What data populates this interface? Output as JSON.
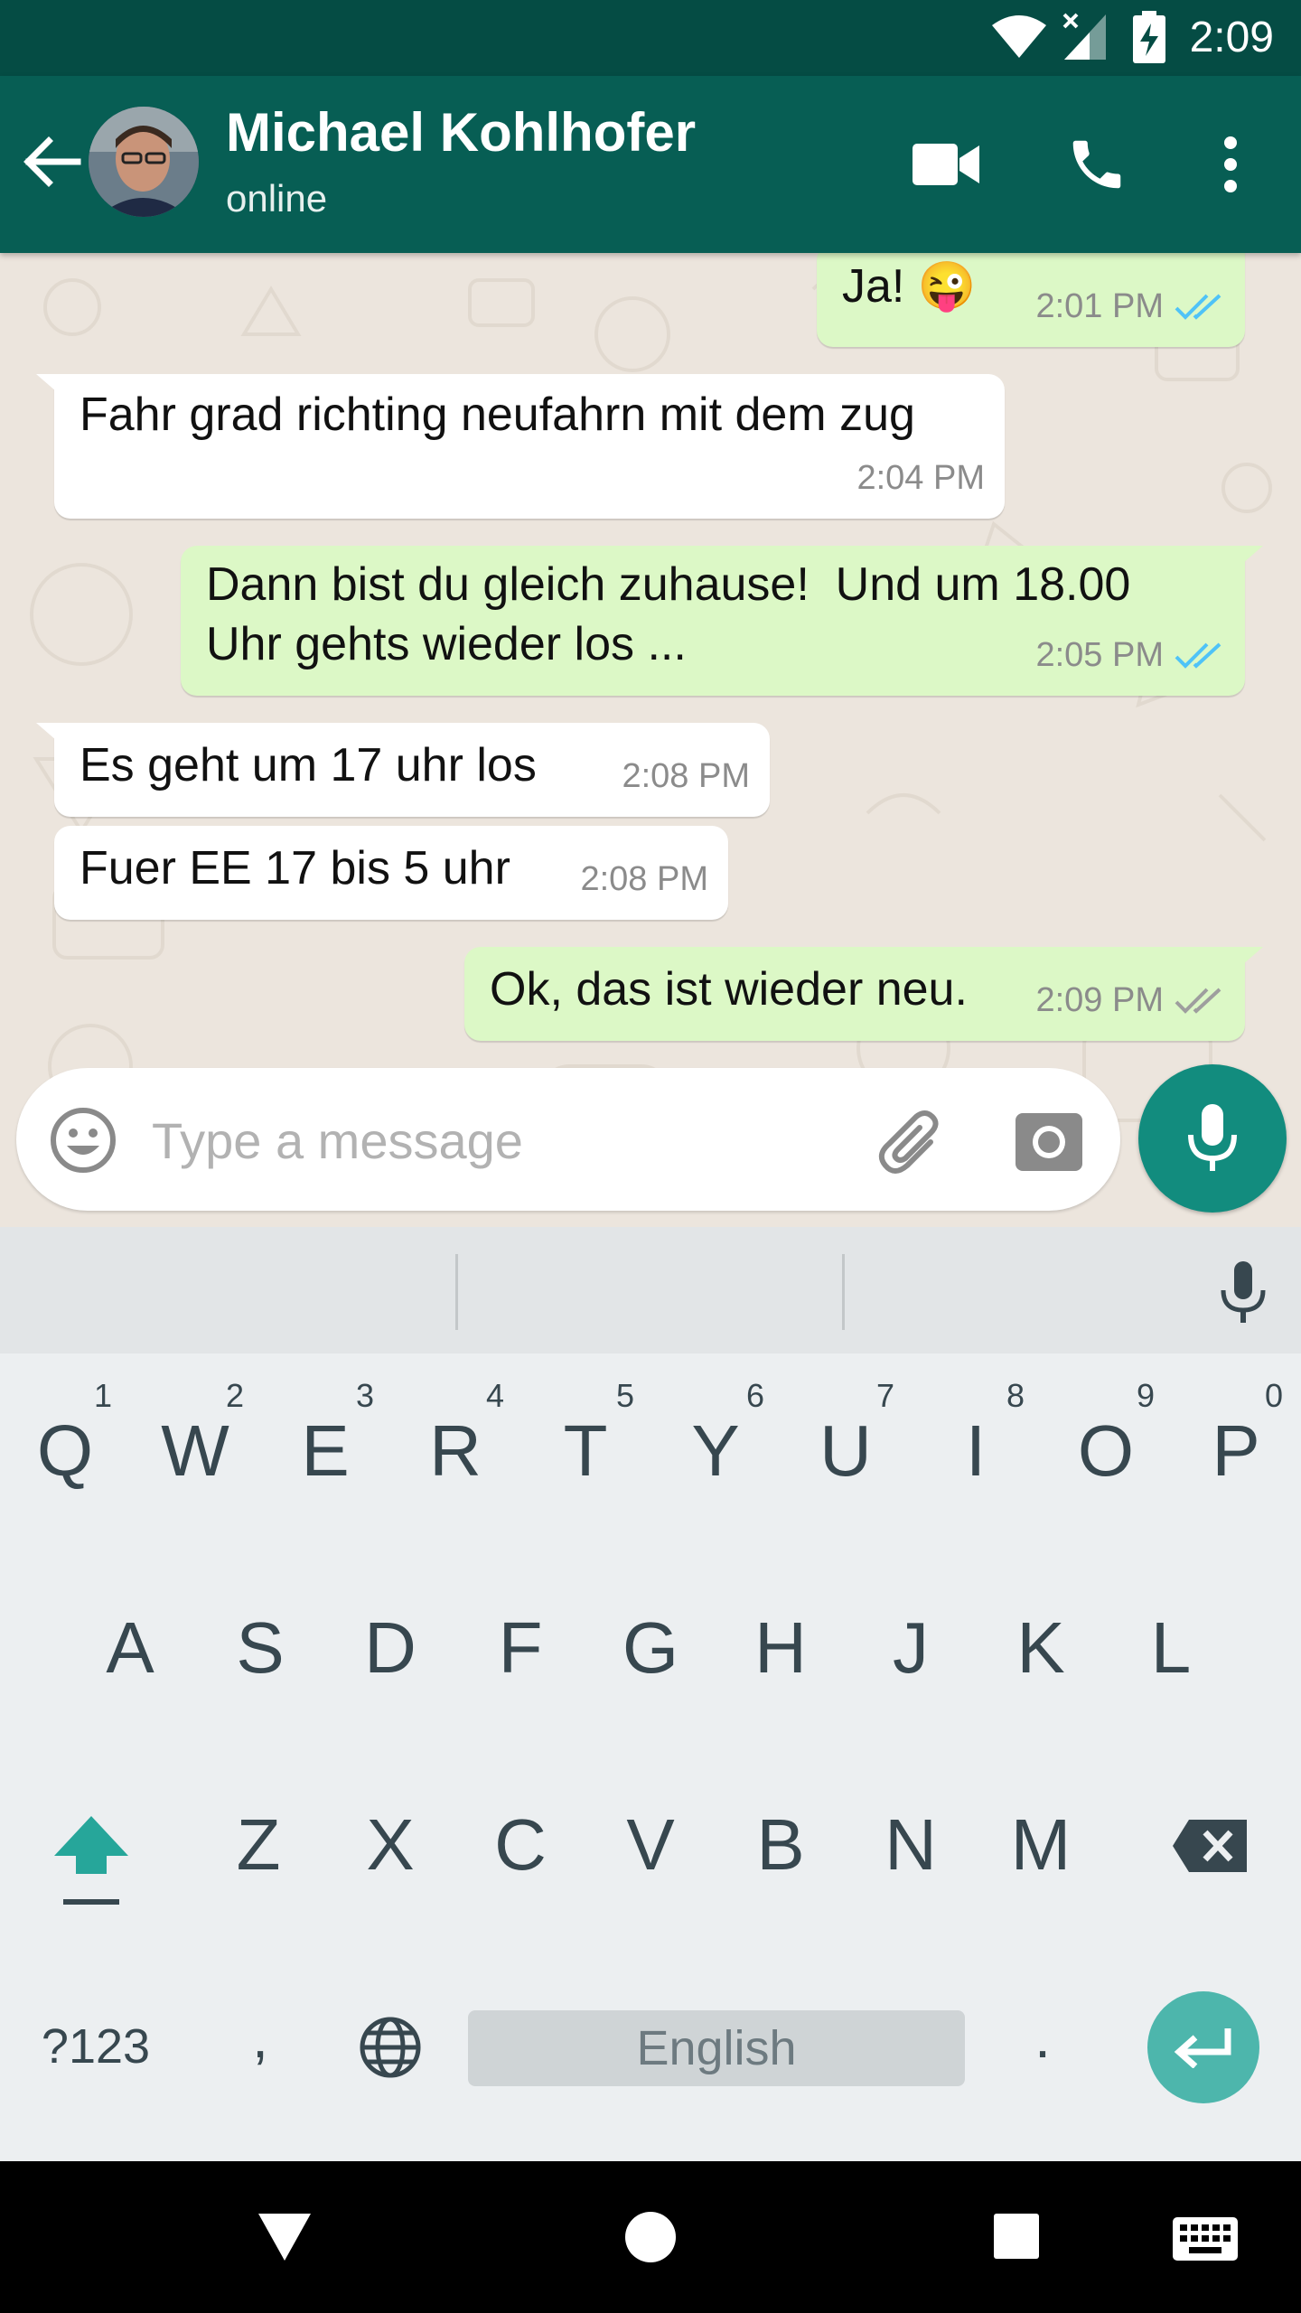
{
  "status_bar": {
    "time": "2:09"
  },
  "header": {
    "contact_name": "Michael Kohlhofer",
    "contact_status": "online"
  },
  "messages": [
    {
      "direction": "out",
      "text": "Ja! 😜",
      "time": "2:01 PM",
      "read": true
    },
    {
      "direction": "in",
      "text": "Fahr grad richting neufahrn mit dem zug",
      "time": "2:04 PM"
    },
    {
      "direction": "out",
      "text": "Dann bist du gleich zuhause!  Und um 18.00\nUhr gehts wieder los ...",
      "time": "2:05 PM",
      "read": true
    },
    {
      "direction": "in",
      "text": "Es geht um 17 uhr los",
      "time": "2:08 PM"
    },
    {
      "direction": "in",
      "text": "Fuer EE 17 bis 5 uhr",
      "time": "2:08 PM"
    },
    {
      "direction": "out",
      "text": "Ok, das ist wieder neu.",
      "time": "2:09 PM",
      "read": false
    }
  ],
  "composer": {
    "placeholder": "Type a message"
  },
  "keyboard": {
    "row1": [
      "Q",
      "W",
      "E",
      "R",
      "T",
      "Y",
      "U",
      "I",
      "O",
      "P"
    ],
    "row1_hints": [
      "1",
      "2",
      "3",
      "4",
      "5",
      "6",
      "7",
      "8",
      "9",
      "0"
    ],
    "row2": [
      "A",
      "S",
      "D",
      "F",
      "G",
      "H",
      "J",
      "K",
      "L"
    ],
    "row3": [
      "Z",
      "X",
      "C",
      "V",
      "B",
      "N",
      "M"
    ],
    "symbols_key": "?123",
    "comma_key": ",",
    "space_label": "English",
    "period_key": "."
  },
  "colors": {
    "header": "#075e54",
    "status_bar": "#054c44",
    "outgoing": "#dcf8c6",
    "incoming": "#ffffff",
    "accent": "#128c7e",
    "read_tick": "#4fc3f7"
  }
}
